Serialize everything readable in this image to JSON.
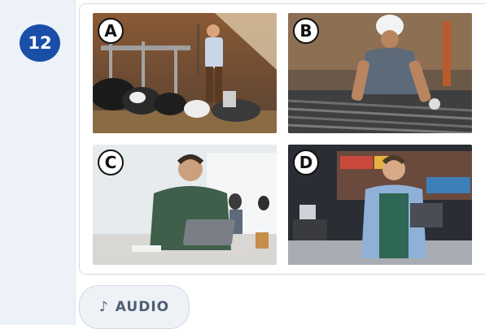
{
  "question": {
    "number": "12"
  },
  "options": [
    {
      "letter": "A",
      "image": "farmer-in-cow-barn"
    },
    {
      "letter": "B",
      "image": "construction-worker-with-hardhat"
    },
    {
      "letter": "C",
      "image": "office-worker-with-laptop"
    },
    {
      "letter": "D",
      "image": "cashier-at-supermarket-checkout"
    }
  ],
  "audio": {
    "icon": "music-note-icon",
    "label": "AUDIO"
  },
  "colors": {
    "badge": "#1a4fa8",
    "rail": "#edf2f9",
    "audio_text": "#4f5f73"
  }
}
